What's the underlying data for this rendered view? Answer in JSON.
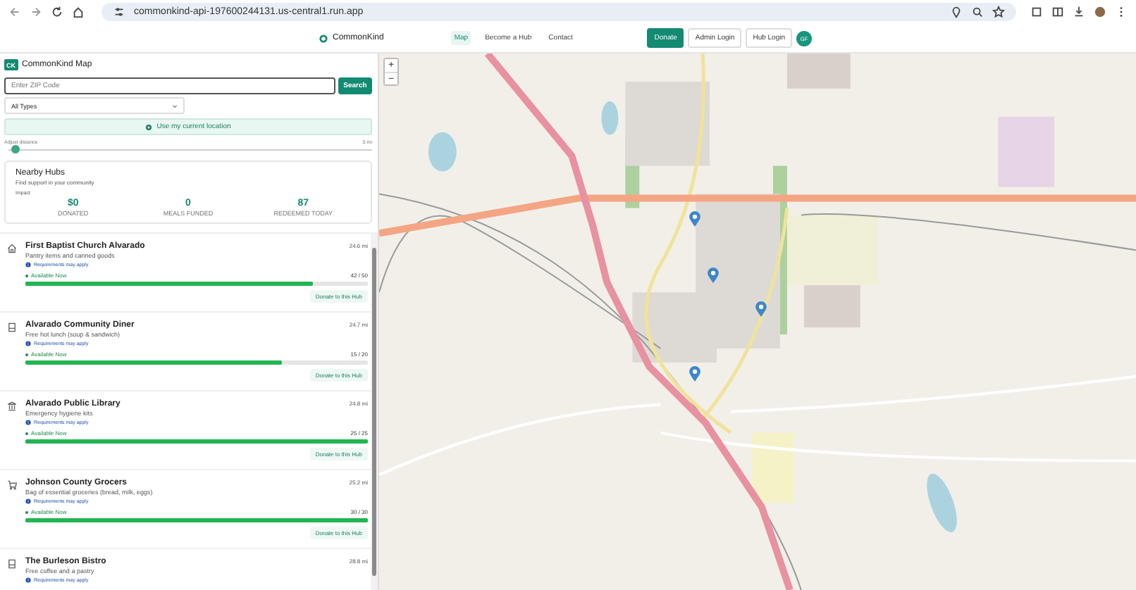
{
  "browser": {
    "url": "commonkind-api-197600244131.us-central1.run.app"
  },
  "nav": {
    "brand": "CommonKind",
    "links": [
      {
        "label": "Map",
        "selected": true
      },
      {
        "label": "Become a Hub",
        "selected": false
      },
      {
        "label": "Contact",
        "selected": false
      }
    ],
    "donate": "Donate",
    "admin_login": "Admin Login",
    "hub_login": "Hub Login",
    "avatar": "GF"
  },
  "sidebar": {
    "title": "CommonKind Map",
    "logo": "CK",
    "zip": {
      "placeholder": "Enter ZIP Code"
    },
    "search": "Search",
    "type_select": "All Types",
    "location_button": "Use my current location",
    "distance": {
      "label": "Adjust distance",
      "reading": "5 mi",
      "level": 0.02
    },
    "summary": {
      "title": "Nearby Hubs",
      "subtitle": "Find support in your community",
      "impact_label": "Impact",
      "stats": [
        {
          "value": "$0",
          "label": "DONATED"
        },
        {
          "value": "0",
          "label": "MEALS FUNDED"
        },
        {
          "value": "87",
          "label": "REDEEMED TODAY"
        }
      ]
    },
    "hubs": [
      {
        "kind": "church",
        "name": "First Baptist Church Alvarado",
        "description": "Pantry items and canned goods",
        "note": "Requirements may apply",
        "status": "Available Now",
        "count": "42 / 50",
        "level": 0.84,
        "distance": "24.6 mi",
        "action": "Donate to this Hub"
      },
      {
        "kind": "diner",
        "name": "Alvarado Community Diner",
        "description": "Free hot lunch (soup & sandwich)",
        "note": "Requirements may apply",
        "status": "Available Now",
        "count": "15 / 20",
        "level": 0.75,
        "distance": "24.7 mi",
        "action": "Donate to this Hub"
      },
      {
        "kind": "library",
        "name": "Alvarado Public Library",
        "description": "Emergency hygiene kits",
        "note": "Requirements may apply",
        "status": "Available Now",
        "count": "25 / 25",
        "level": 1,
        "distance": "24.8 mi",
        "action": "Donate to this Hub"
      },
      {
        "kind": "grocery",
        "name": "Johnson County Grocers",
        "description": "Bag of essential groceries (bread, milk, eggs)",
        "note": "Requirements may apply",
        "status": "Available Now",
        "count": "30 / 30",
        "level": 1,
        "distance": "25.2 mi",
        "action": "Donate to this Hub"
      },
      {
        "kind": "diner",
        "name": "The Burleson Bistro",
        "description": "Free coffee and a pastry",
        "note": "Requirements may apply",
        "distance": "28.8 mi"
      }
    ]
  },
  "map": {
    "zoom_in": "+",
    "zoom_out": "−"
  }
}
